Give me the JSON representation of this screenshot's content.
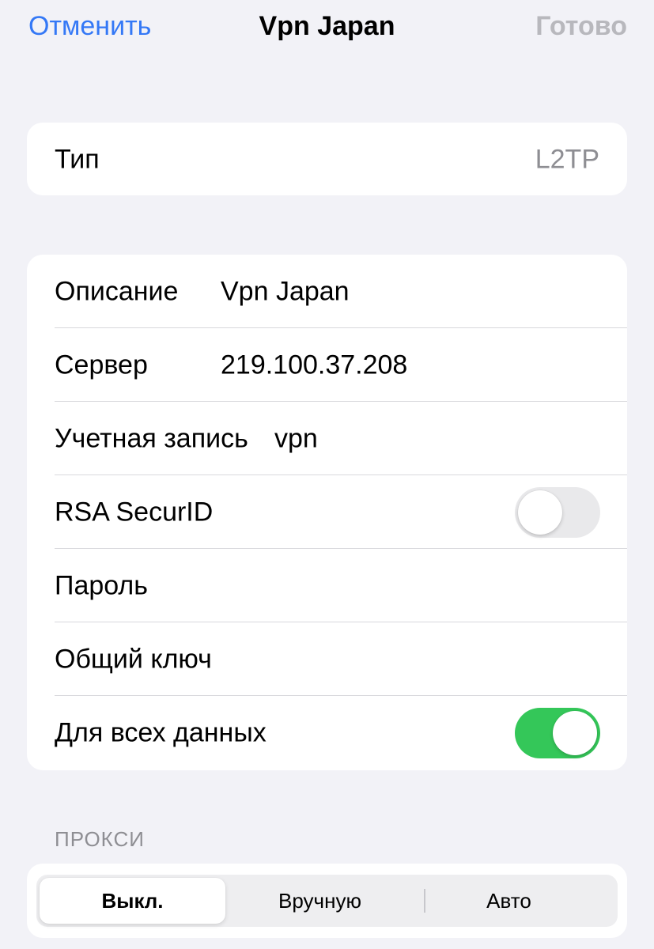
{
  "navbar": {
    "cancel_label": "Отменить",
    "title": "Vpn Japan",
    "done_label": "Готово"
  },
  "type_row": {
    "label": "Тип",
    "value": "L2TP"
  },
  "form": {
    "description": {
      "label": "Описание",
      "value": "Vpn Japan"
    },
    "server": {
      "label": "Сервер",
      "value": "219.100.37.208"
    },
    "account": {
      "label": "Учетная запись",
      "value": "vpn"
    },
    "rsa": {
      "label": "RSA SecurID",
      "state": "off"
    },
    "password": {
      "label": "Пароль",
      "value": ""
    },
    "shared_key": {
      "label": "Общий ключ",
      "value": ""
    },
    "send_all": {
      "label": "Для всех данных",
      "state": "on"
    }
  },
  "proxy": {
    "header": "ПРОКСИ",
    "options": [
      "Выкл.",
      "Вручную",
      "Авто"
    ],
    "selected": "Выкл."
  },
  "colors": {
    "accent": "#3478f6",
    "toggle_on": "#34c759",
    "background": "#f2f2f7",
    "disabled_text": "#b8b8bd"
  }
}
